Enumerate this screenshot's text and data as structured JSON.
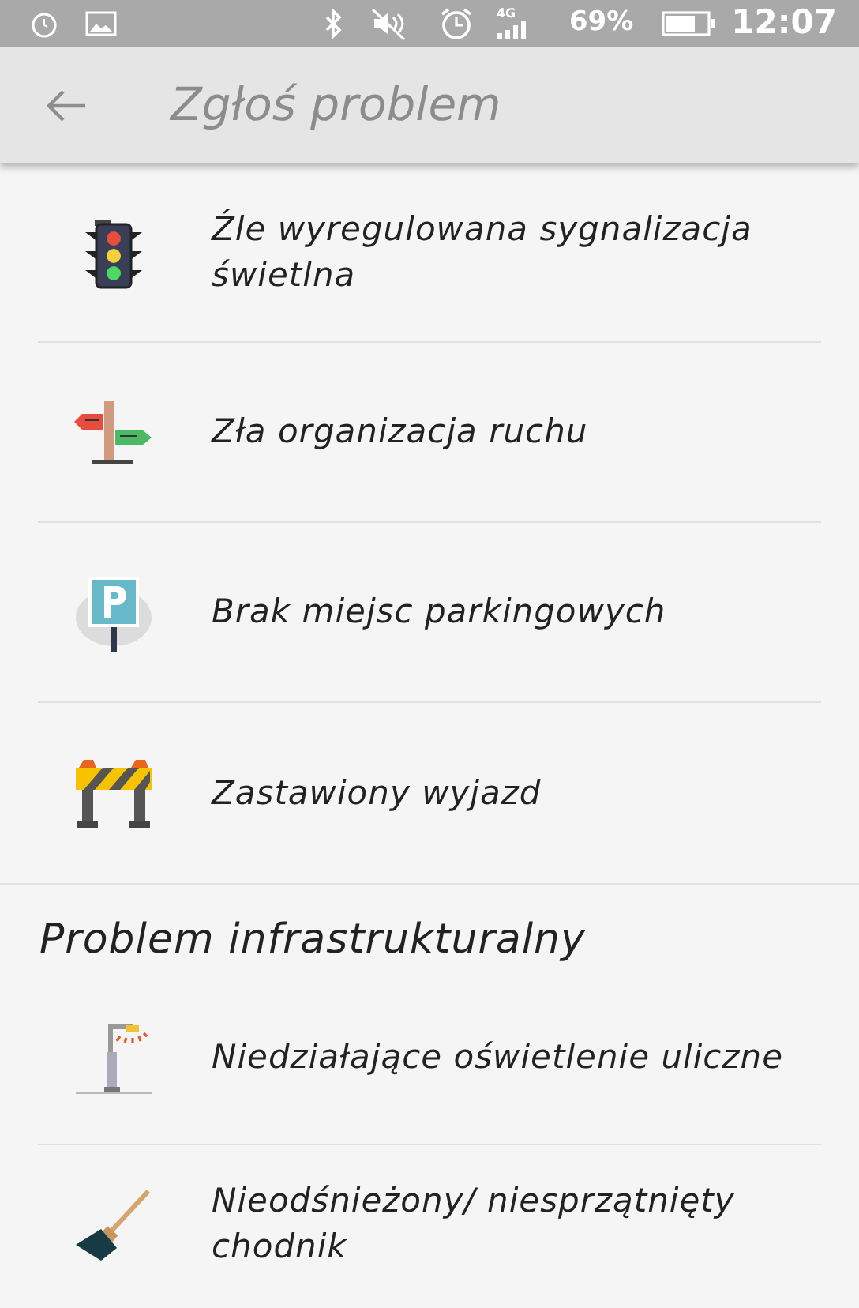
{
  "status_bar": {
    "network": "4G",
    "battery": "69%",
    "time": "12:07"
  },
  "app_bar": {
    "title": "Zgłoś problem"
  },
  "sections": [
    {
      "items": [
        {
          "label": "Źle wyregulowana sygnalizacja świetlna"
        },
        {
          "label": "Zła organizacja ruchu"
        },
        {
          "label": "Brak miejsc parkingowych"
        },
        {
          "label": "Zastawiony wyjazd"
        }
      ]
    },
    {
      "title": "Problem infrastrukturalny",
      "items": [
        {
          "label": "Niedziałające oświetlenie uliczne"
        },
        {
          "label": "Nieodśnieżony/ niesprzątnięty chodnik"
        }
      ]
    }
  ]
}
